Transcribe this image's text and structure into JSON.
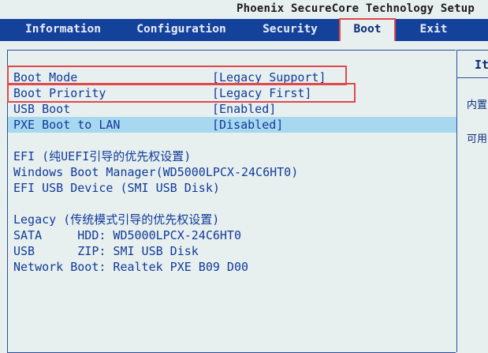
{
  "header": {
    "title": "Phoenix SecureCore Technology Setup"
  },
  "menu": {
    "tabs": [
      {
        "label": "Information"
      },
      {
        "label": "Configuration"
      },
      {
        "label": "Security"
      },
      {
        "label": "Boot"
      },
      {
        "label": "Exit"
      }
    ],
    "active": "Boot"
  },
  "settings": [
    {
      "label": "Boot Mode",
      "value": "[Legacy Support]"
    },
    {
      "label": "Boot Priority",
      "value": "[Legacy First]"
    },
    {
      "label": "USB Boot",
      "value": "[Enabled]"
    },
    {
      "label": "PXE Boot to LAN",
      "value": "[Disabled]"
    }
  ],
  "efi": {
    "heading": "EFI (纯UEFI引导的优先权设置)",
    "items": [
      "Windows Boot Manager(WD5000LPCX-24C6HT0)",
      "EFI USB Device (SMI USB Disk)"
    ]
  },
  "legacy": {
    "heading": "Legacy (传统模式引导的优先权设置)",
    "items": [
      "SATA     HDD: WD5000LPCX-24C6HT0",
      "USB      ZIP: SMI USB Disk",
      "Network Boot: Realtek PXE B09 D00"
    ]
  },
  "help": {
    "heading": "It",
    "line1": "内置",
    "line2": "可用"
  },
  "colors": {
    "menubar": "#14429b",
    "background": "#e7f0ef",
    "text": "#123a9a",
    "selection": "#a7d8f0",
    "highlight": "#e0484c"
  }
}
